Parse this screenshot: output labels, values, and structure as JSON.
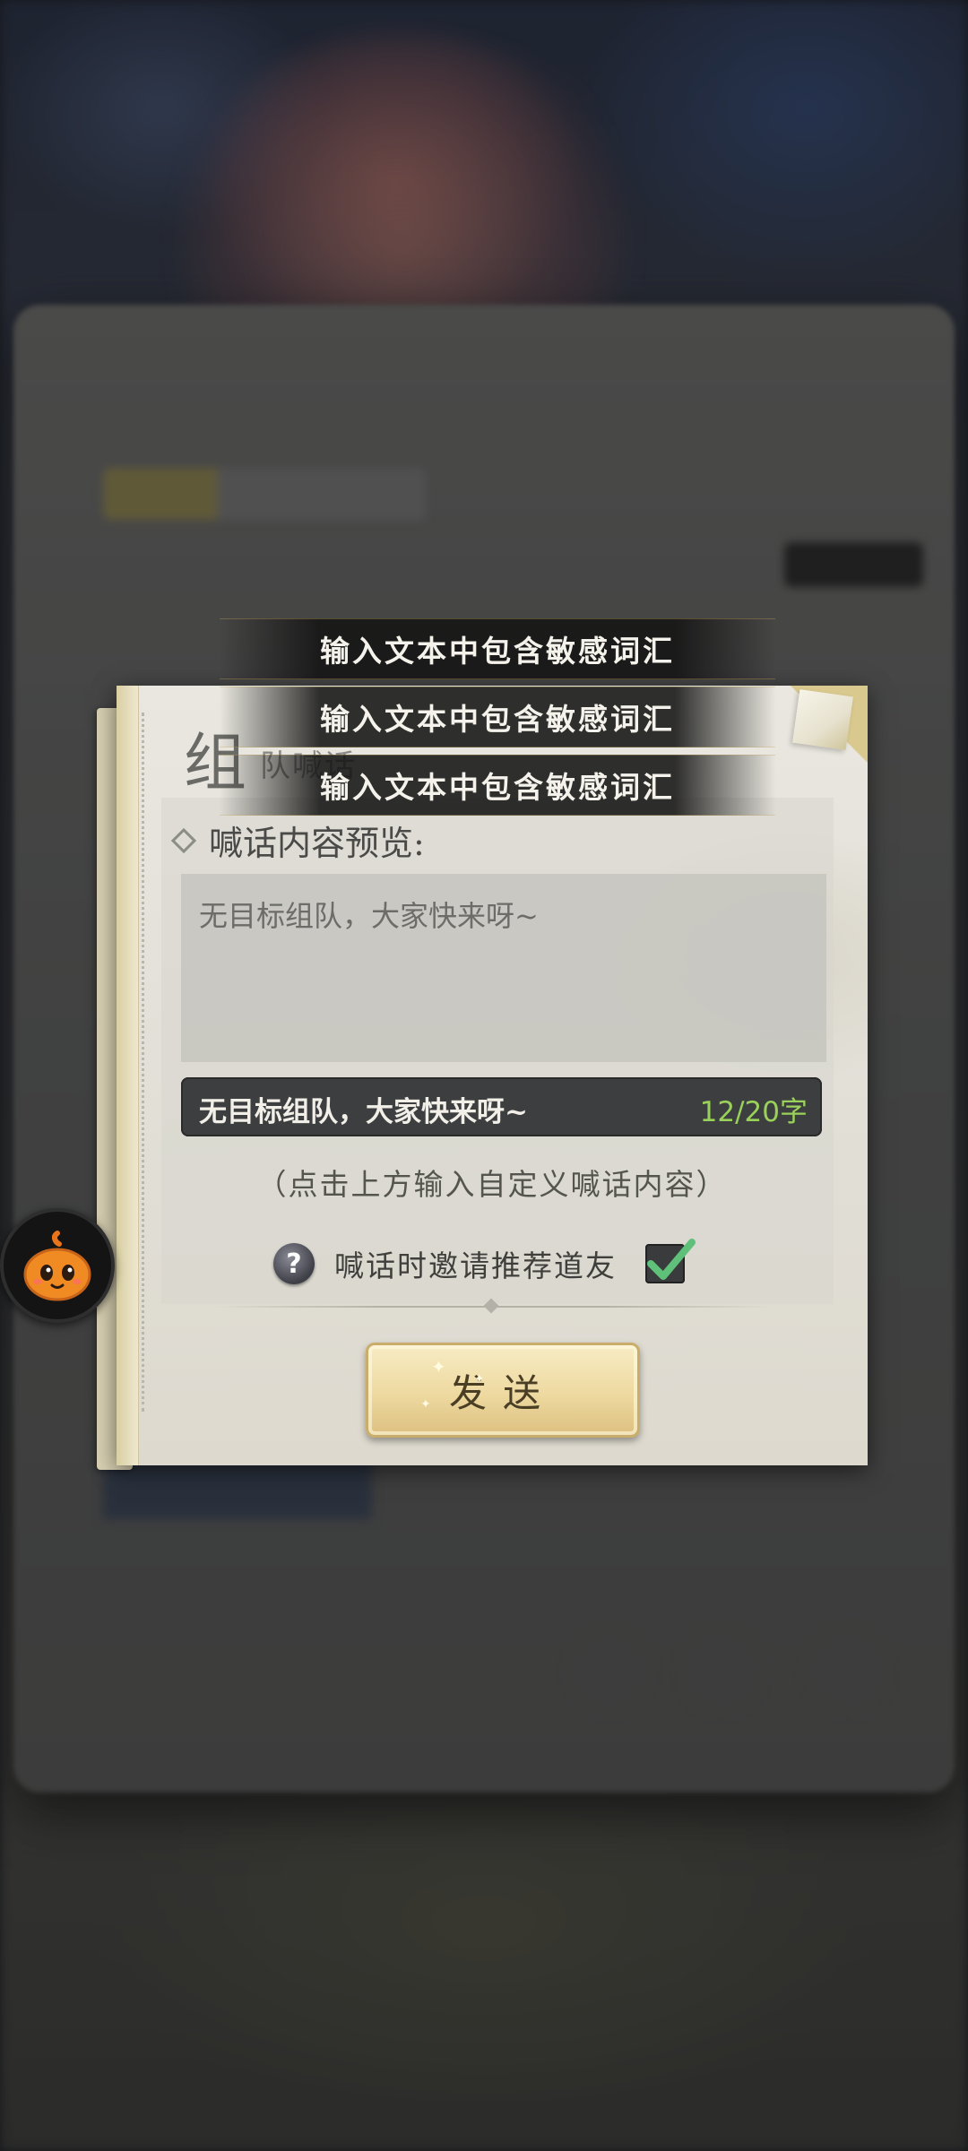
{
  "toasts": [
    "输入文本中包含敏感词汇",
    "输入文本中包含敏感词汇",
    "输入文本中包含敏感词汇"
  ],
  "dialog": {
    "title_big": "组",
    "title_small": "队喊话",
    "preview_label": "喊话内容预览:",
    "preview_text": "无目标组队，大家快来呀~",
    "input_text": "无目标组队，大家快来呀~",
    "char_count": "12/20字",
    "hint": "（点击上方输入自定义喊话内容）",
    "invite_label": "喊话时邀请推荐道友",
    "invite_checked": true,
    "send_label": "发送"
  },
  "icons": {
    "help": "question-icon",
    "checkbox": "check-icon",
    "assistant": "pumpkin-mascot-icon"
  },
  "colors": {
    "char_count": "#9ad15a",
    "check_mark": "#5fc07a",
    "send_button": "#eed9a0"
  }
}
